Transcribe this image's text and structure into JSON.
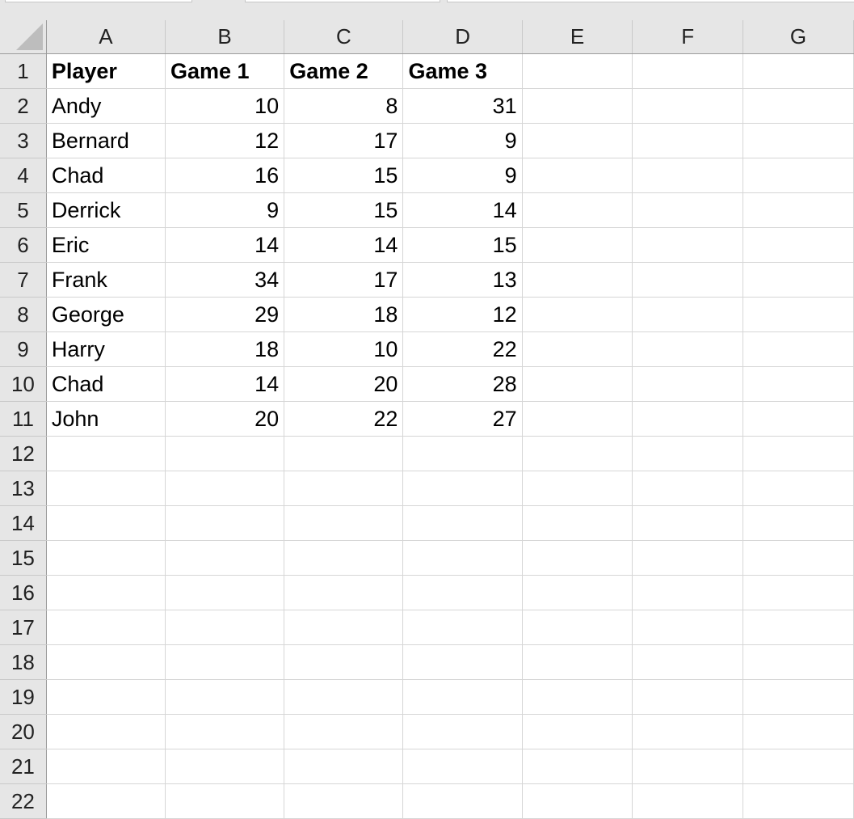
{
  "columns": [
    "A",
    "B",
    "C",
    "D",
    "E",
    "F",
    "G"
  ],
  "row_numbers": [
    1,
    2,
    3,
    4,
    5,
    6,
    7,
    8,
    9,
    10,
    11,
    12,
    13,
    14,
    15,
    16,
    17,
    18,
    19,
    20,
    21,
    22
  ],
  "header": [
    "Player",
    "Game 1",
    "Game 2",
    "Game 3"
  ],
  "rows": [
    [
      "Andy",
      "10",
      "8",
      "31"
    ],
    [
      "Bernard",
      "12",
      "17",
      "9"
    ],
    [
      "Chad",
      "16",
      "15",
      "9"
    ],
    [
      "Derrick",
      "9",
      "15",
      "14"
    ],
    [
      "Eric",
      "14",
      "14",
      "15"
    ],
    [
      "Frank",
      "34",
      "17",
      "13"
    ],
    [
      "George",
      "29",
      "18",
      "12"
    ],
    [
      "Harry",
      "18",
      "10",
      "22"
    ],
    [
      "Chad",
      "14",
      "20",
      "28"
    ],
    [
      "John",
      "20",
      "22",
      "27"
    ]
  ],
  "icons": {
    "select_all": "select-all-triangle"
  }
}
